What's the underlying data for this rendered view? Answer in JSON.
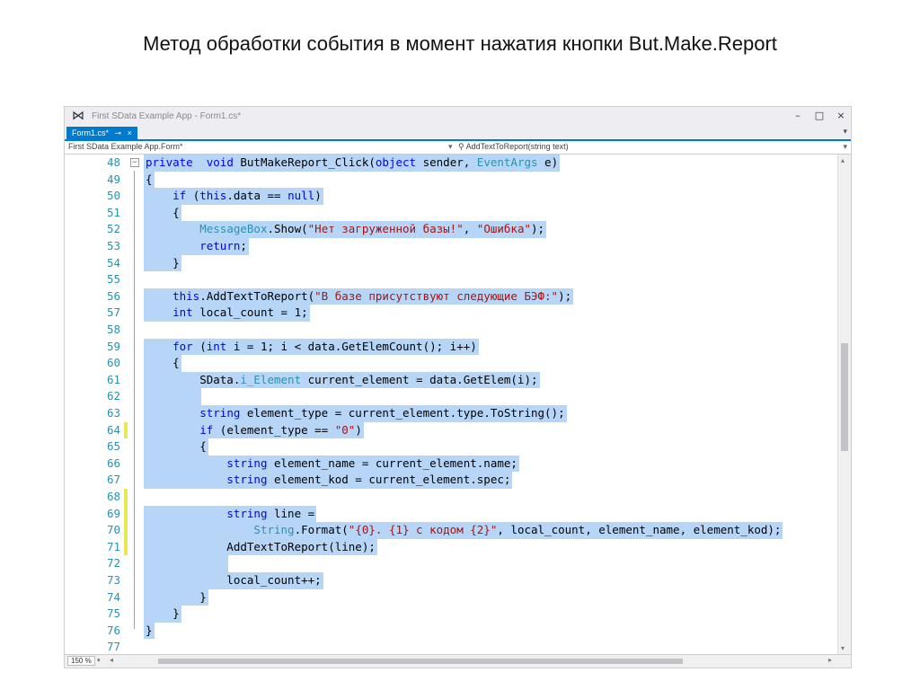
{
  "slide_title": "Метод обработки события в момент нажатия кнопки But.Make.Report",
  "window": {
    "title": "First SData Example App - Form1.cs*",
    "minimize": "–",
    "maximize": "□",
    "close": "×"
  },
  "tab": {
    "label": "Form1.cs*",
    "pin": "⊸",
    "close": "×",
    "overflow": "▾"
  },
  "navbar": {
    "class": "First SData Example App.Form*",
    "member": "⚲ AddTextToReport(string text)",
    "dropdown": "▾"
  },
  "editor": {
    "lines": [
      {
        "n": "48",
        "marker": "",
        "collapse": "−",
        "tokens": [
          [
            "kw",
            "private"
          ],
          [
            "",
            "  "
          ],
          [
            "kw",
            "void"
          ],
          [
            "",
            " ButMakeReport_Click("
          ],
          [
            "kw",
            "object"
          ],
          [
            "",
            " sender, "
          ],
          [
            "ty",
            "EventArgs"
          ],
          [
            "",
            " e)"
          ]
        ]
      },
      {
        "n": "49",
        "marker": "",
        "collapse": "",
        "tokens": [
          [
            "",
            "{"
          ]
        ]
      },
      {
        "n": "50",
        "marker": "",
        "collapse": "",
        "tokens": [
          [
            "",
            "    "
          ],
          [
            "kw",
            "if"
          ],
          [
            "",
            " ("
          ],
          [
            "kw",
            "this"
          ],
          [
            "",
            ".data == "
          ],
          [
            "kw",
            "null"
          ],
          [
            "",
            ")"
          ]
        ]
      },
      {
        "n": "51",
        "marker": "",
        "collapse": "",
        "tokens": [
          [
            "",
            "    {"
          ]
        ]
      },
      {
        "n": "52",
        "marker": "",
        "collapse": "",
        "tokens": [
          [
            "",
            "        "
          ],
          [
            "ty",
            "MessageBox"
          ],
          [
            "",
            ".Show("
          ],
          [
            "str",
            "\"Нет загруженной базы!\""
          ],
          [
            "",
            ", "
          ],
          [
            "str",
            "\"Ошибка\""
          ],
          [
            "",
            ");"
          ]
        ]
      },
      {
        "n": "53",
        "marker": "",
        "collapse": "",
        "tokens": [
          [
            "",
            "        "
          ],
          [
            "kw",
            "return"
          ],
          [
            "",
            ";"
          ]
        ]
      },
      {
        "n": "54",
        "marker": "",
        "collapse": "",
        "tokens": [
          [
            "",
            "    }"
          ]
        ]
      },
      {
        "n": "55",
        "marker": "",
        "collapse": "",
        "tokens": []
      },
      {
        "n": "56",
        "marker": "",
        "collapse": "",
        "tokens": [
          [
            "",
            "    "
          ],
          [
            "kw",
            "this"
          ],
          [
            "",
            ".AddTextToReport("
          ],
          [
            "str",
            "\"В базе присутствуют следующие БЭФ:\""
          ],
          [
            "",
            ");"
          ]
        ]
      },
      {
        "n": "57",
        "marker": "",
        "collapse": "",
        "tokens": [
          [
            "",
            "    "
          ],
          [
            "kw",
            "int"
          ],
          [
            "",
            " local_count = 1;"
          ]
        ]
      },
      {
        "n": "58",
        "marker": "",
        "collapse": "",
        "tokens": []
      },
      {
        "n": "59",
        "marker": "",
        "collapse": "",
        "tokens": [
          [
            "",
            "    "
          ],
          [
            "kw",
            "for"
          ],
          [
            "",
            " ("
          ],
          [
            "kw",
            "int"
          ],
          [
            "",
            " i = 1; i < data.GetElemCount(); i++)"
          ]
        ]
      },
      {
        "n": "60",
        "marker": "",
        "collapse": "",
        "tokens": [
          [
            "",
            "    {"
          ]
        ]
      },
      {
        "n": "61",
        "marker": "",
        "collapse": "",
        "tokens": [
          [
            "",
            "        SData."
          ],
          [
            "ty",
            "i_Element"
          ],
          [
            "",
            " current_element = data.GetElem(i);"
          ]
        ]
      },
      {
        "n": "62",
        "marker": "",
        "collapse": "",
        "tokens": [
          [
            "",
            "        "
          ]
        ]
      },
      {
        "n": "63",
        "marker": "",
        "collapse": "",
        "tokens": [
          [
            "",
            "        "
          ],
          [
            "kw",
            "string"
          ],
          [
            "",
            " element_type = current_element.type.ToString();"
          ]
        ]
      },
      {
        "n": "64",
        "marker": "saved",
        "collapse": "",
        "tokens": [
          [
            "",
            "        "
          ],
          [
            "kw",
            "if"
          ],
          [
            "",
            " (element_type == "
          ],
          [
            "str",
            "\"0\""
          ],
          [
            "",
            ")"
          ]
        ]
      },
      {
        "n": "65",
        "marker": "",
        "collapse": "",
        "tokens": [
          [
            "",
            "        {"
          ]
        ]
      },
      {
        "n": "66",
        "marker": "",
        "collapse": "",
        "tokens": [
          [
            "",
            "            "
          ],
          [
            "kw",
            "string"
          ],
          [
            "",
            " element_name = current_element.name;"
          ]
        ]
      },
      {
        "n": "67",
        "marker": "",
        "collapse": "",
        "tokens": [
          [
            "",
            "            "
          ],
          [
            "kw",
            "string"
          ],
          [
            "",
            " element_kod = current_element.spec;"
          ]
        ]
      },
      {
        "n": "68",
        "marker": "saved",
        "collapse": "",
        "tokens": []
      },
      {
        "n": "69",
        "marker": "saved",
        "collapse": "",
        "tokens": [
          [
            "",
            "            "
          ],
          [
            "kw",
            "string"
          ],
          [
            "",
            " line ="
          ]
        ]
      },
      {
        "n": "70",
        "marker": "saved",
        "collapse": "",
        "tokens": [
          [
            "",
            "                "
          ],
          [
            "ty",
            "String"
          ],
          [
            "",
            ".Format("
          ],
          [
            "str",
            "\"{0}. {1} с кодом {2}\""
          ],
          [
            "",
            ", local_count, element_name, element_kod);"
          ]
        ]
      },
      {
        "n": "71",
        "marker": "saved",
        "collapse": "",
        "tokens": [
          [
            "",
            "            AddTextToReport(line);"
          ]
        ]
      },
      {
        "n": "72",
        "marker": "",
        "collapse": "",
        "tokens": [
          [
            "",
            "            "
          ]
        ]
      },
      {
        "n": "73",
        "marker": "",
        "collapse": "",
        "tokens": [
          [
            "",
            "            local_count++;"
          ]
        ]
      },
      {
        "n": "74",
        "marker": "",
        "collapse": "",
        "tokens": [
          [
            "",
            "        }"
          ]
        ]
      },
      {
        "n": "75",
        "marker": "",
        "collapse": "",
        "tokens": [
          [
            "",
            "    }"
          ]
        ]
      },
      {
        "n": "76",
        "marker": "",
        "collapse": "",
        "tokens": [
          [
            "",
            "}"
          ]
        ]
      },
      {
        "n": "77",
        "marker": "",
        "collapse": "",
        "tokens": []
      }
    ]
  },
  "statusbar": {
    "zoom": "150 %",
    "zoom_dd": "▾",
    "scroll_left": "◂",
    "scroll_right": "▸"
  },
  "scrollbar": {
    "up": "▴",
    "down": "▾",
    "split": "⸗"
  },
  "colors": {
    "selection": "#b7d6f7",
    "keyword": "#0000ff",
    "type": "#2b91af",
    "string": "#a31515",
    "line_number": "#2b91af",
    "accent": "#007acc"
  }
}
